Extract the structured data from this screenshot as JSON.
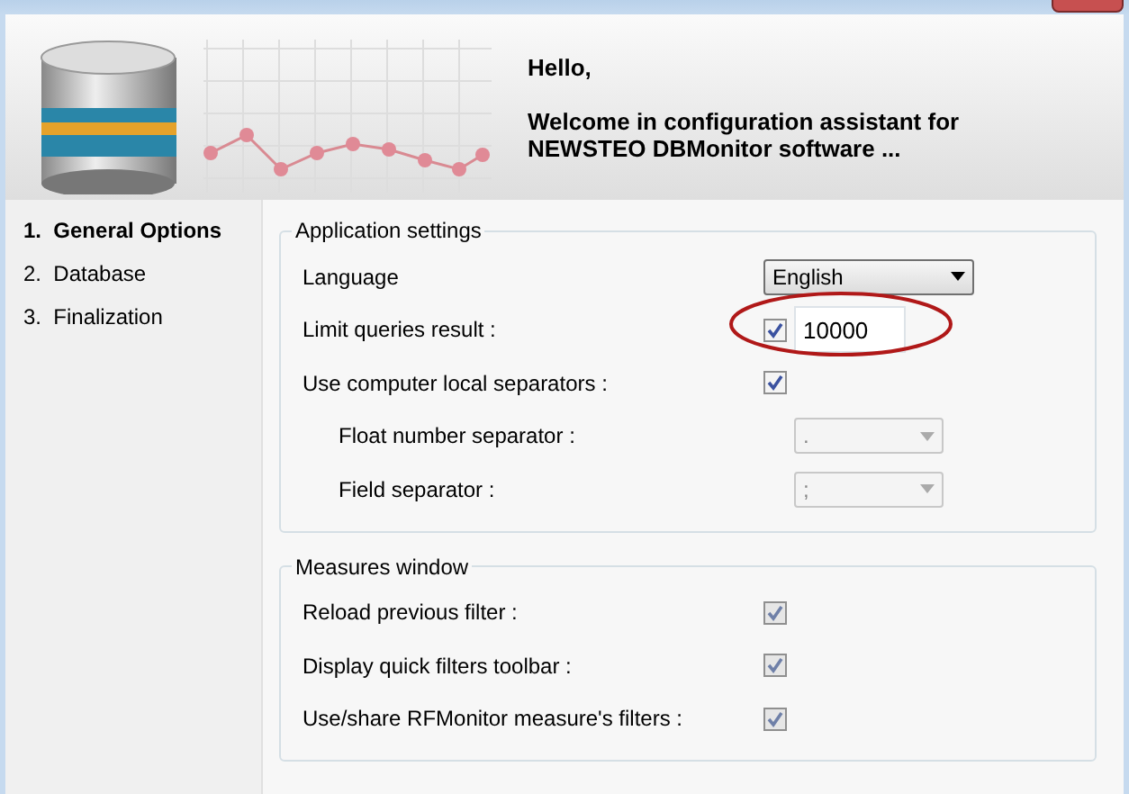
{
  "header": {
    "greeting": "Hello,",
    "message": "Welcome in configuration assistant for NEWSTEO DBMonitor software ..."
  },
  "steps": [
    {
      "label": "1.  General Options",
      "selected": true
    },
    {
      "label": "2.  Database",
      "selected": false
    },
    {
      "label": "3.  Finalization",
      "selected": false
    }
  ],
  "groups": [
    {
      "title": "Application settings",
      "rows": [
        {
          "kind": "dropdown",
          "label": "Language",
          "value": "English",
          "disabled": false,
          "indent": false
        },
        {
          "kind": "checkbox_input",
          "label": "Limit queries result :",
          "checked": true,
          "value": "10000",
          "highlighted": true
        },
        {
          "kind": "checkbox",
          "label": "Use computer local separators :",
          "checked": true,
          "disabled": false
        },
        {
          "kind": "dropdown",
          "label": "Float number separator :",
          "value": ".",
          "disabled": true,
          "indent": true
        },
        {
          "kind": "dropdown",
          "label": "Field separator :",
          "value": ";",
          "disabled": true,
          "indent": true
        }
      ]
    },
    {
      "title": "Measures window",
      "rows": [
        {
          "kind": "checkbox",
          "label": "Reload previous filter :",
          "checked": true,
          "disabled": true
        },
        {
          "kind": "checkbox",
          "label": "Display quick filters toolbar :",
          "checked": true,
          "disabled": true
        },
        {
          "kind": "checkbox",
          "label": "Use/share RFMonitor measure's filters :",
          "checked": true,
          "disabled": true
        }
      ]
    }
  ]
}
